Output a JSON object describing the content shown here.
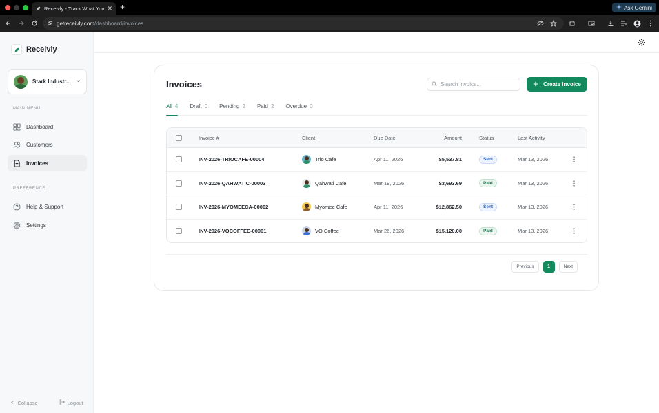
{
  "browser": {
    "tab_title": "Receivly - Track What You're Owed",
    "url_host": "getreceivly.com",
    "url_path": "/dashboard/invoices",
    "ask_gemini": "Ask Gemini"
  },
  "sidebar": {
    "brand": "Receivly",
    "org_name": "Stark Industr...",
    "main_menu_label": "MAIN MENU",
    "main_items": [
      {
        "label": "Dashboard",
        "icon": "grid-icon"
      },
      {
        "label": "Customers",
        "icon": "users-icon"
      },
      {
        "label": "Invoices",
        "icon": "document-icon",
        "active": true
      }
    ],
    "preference_label": "PREFERENCE",
    "pref_items": [
      {
        "label": "Help & Support",
        "icon": "help-icon"
      },
      {
        "label": "Settings",
        "icon": "gear-icon"
      }
    ],
    "collapse": "Collapse",
    "logout": "Logout"
  },
  "page": {
    "title": "Invoices",
    "search_placeholder": "Search invoice...",
    "create_button": "Create invoice",
    "tabs": [
      {
        "label": "All",
        "count": "4",
        "active": true
      },
      {
        "label": "Draft",
        "count": "0"
      },
      {
        "label": "Pending",
        "count": "2"
      },
      {
        "label": "Paid",
        "count": "2"
      },
      {
        "label": "Overdue",
        "count": "0"
      }
    ]
  },
  "table": {
    "headers": {
      "invoice": "Invoice #",
      "client": "Client",
      "due": "Due Date",
      "amount": "Amount",
      "status": "Status",
      "last": "Last Activity"
    },
    "rows": [
      {
        "invoice": "INV-2026-TRIOCAFE-00004",
        "client": "Trio Cafe",
        "due": "Apr 11, 2026",
        "amount": "$5,537.81",
        "status": "Sent",
        "last": "Mar 13, 2026",
        "avatar_color": "#6ab0c4",
        "body_color": "#2f8f6a"
      },
      {
        "invoice": "INV-2026-QAHWATIC-00003",
        "client": "Qahwati Cafe",
        "due": "Mar 19, 2026",
        "amount": "$3,693.69",
        "status": "Paid",
        "last": "Mar 13, 2026",
        "avatar_color": "#e8e8e8",
        "body_color": "#2f8f6a"
      },
      {
        "invoice": "INV-2026-MYOMEECA-00002",
        "client": "Myomee Cafe",
        "due": "Apr 11, 2026",
        "amount": "$12,862.50",
        "status": "Sent",
        "last": "Mar 13, 2026",
        "avatar_color": "#f2c94c",
        "body_color": "#8a5a2b"
      },
      {
        "invoice": "INV-2026-VOCOFFEE-00001",
        "client": "VO Coffee",
        "due": "Mar 26, 2026",
        "amount": "$15,120.00",
        "status": "Paid",
        "last": "Mar 13, 2026",
        "avatar_color": "#c9d3e6",
        "body_color": "#3b6fd1"
      }
    ]
  },
  "pagination": {
    "previous": "Previous",
    "current": "1",
    "next": "Next"
  },
  "colors": {
    "accent": "#138a5e",
    "sent_badge": "#2d5fb8",
    "paid_badge": "#1e7a52"
  }
}
